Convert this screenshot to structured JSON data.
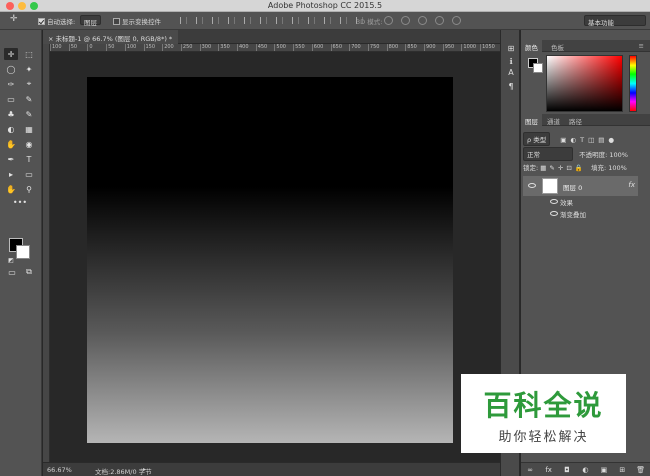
{
  "window": {
    "title": "Adobe Photoshop CC 2015.5",
    "traffic_lights": [
      "#fc605c",
      "#fdbc40",
      "#34c84a"
    ]
  },
  "options_bar": {
    "move_glyph": "✛",
    "auto_select_label": "自动选择:",
    "auto_select_value": "图层",
    "show_transform_label": "显示变换控件",
    "mode_label": "3D 模式:",
    "workspace": "基本功能"
  },
  "document": {
    "tab_title": "未标题-1 @ 66.7% (图层 0, RGB/8*) *",
    "close_glyph": "×",
    "ruler_ticks": [
      "100",
      "50",
      "0",
      "50",
      "100",
      "150",
      "200",
      "250",
      "300",
      "350",
      "400",
      "450",
      "500",
      "550",
      "600",
      "650",
      "700",
      "750",
      "800",
      "850",
      "900",
      "950",
      "1000",
      "1050"
    ],
    "zoom": "66.67%",
    "doc_info": "文档:2.86M/0 字节",
    "gradient": [
      "#000000",
      "#5a5a5a",
      "#b5b5b5"
    ]
  },
  "tools": {
    "glyphs": [
      "✛",
      "⬚",
      "◯",
      "✦",
      "✑",
      "⌖",
      "▭",
      "✎",
      "♣",
      "✎",
      "◐",
      "▦",
      "✋",
      "◉",
      "✒",
      "T",
      "▸",
      "▭",
      "✋",
      "⚲"
    ],
    "more_glyph": "•••",
    "fg_color": "#000000",
    "bg_color": "#ffffff"
  },
  "panel_strip": {
    "icons": [
      "⊞",
      "ℹ",
      "A",
      "¶"
    ]
  },
  "color_panel": {
    "tabs": [
      "颜色",
      "色板"
    ],
    "menu_glyph": "≡"
  },
  "layers_panel": {
    "tabs": [
      "图层",
      "通道",
      "路径"
    ],
    "filter_label": "ρ 类型",
    "blend_mode": "正常",
    "opacity_label": "不透明度:",
    "opacity_value": "100%",
    "lock_label": "锁定:",
    "fill_label": "填充:",
    "fill_value": "100%",
    "layer_name": "图层 0",
    "fx_glyph": "fx",
    "effects_label": "效果",
    "effect_item": "渐变叠加",
    "footer_icons": [
      "∞",
      "fx",
      "◘",
      "◐",
      "▣",
      "⊞",
      "🗑"
    ]
  },
  "watermark": {
    "big_text": "百科全说",
    "small_text": "助你轻松解决"
  }
}
